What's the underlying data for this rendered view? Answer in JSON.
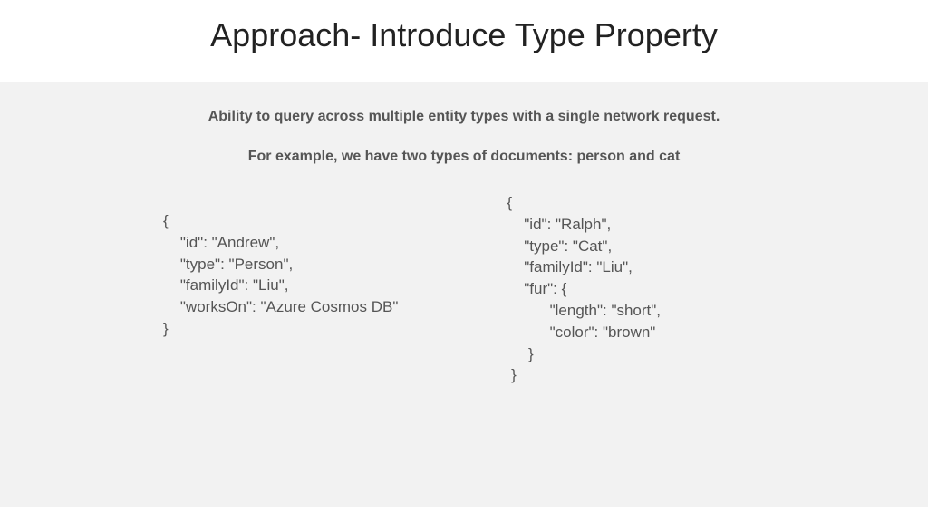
{
  "slide": {
    "title": "Approach- Introduce Type Property",
    "subtitle1": "Ability to query across multiple entity types with a single network request.",
    "subtitle2": "For example, we have two types of documents: person and cat",
    "code_left": "{\n    \"id\": \"Andrew\",\n    \"type\": \"Person\",\n    \"familyId\": \"Liu\",\n    \"worksOn\": \"Azure Cosmos DB\"\n}",
    "code_right": "{\n    \"id\": \"Ralph\",\n    \"type\": \"Cat\",\n    \"familyId\": \"Liu\",\n    \"fur\": {\n          \"length\": \"short\",\n          \"color\": \"brown\"\n     }\n }"
  }
}
